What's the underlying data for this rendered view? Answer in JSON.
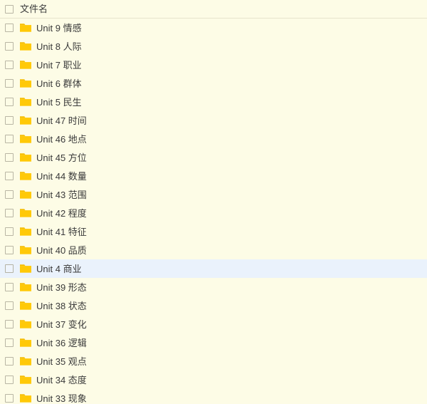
{
  "colors": {
    "background": "#fdfce6",
    "row_selected": "#eaf2fc",
    "folder_icon": "#ffc907",
    "folder_icon_tab": "#f5bd05",
    "text": "#3a3a3a",
    "checkbox_border": "#b9b6a4",
    "divider": "#e7e4cd"
  },
  "header": {
    "select_all_checkbox": "unchecked",
    "label": "文件名"
  },
  "files": [
    {
      "name": "Unit 9 情感",
      "icon": "folder-icon",
      "checked": false,
      "selected": false
    },
    {
      "name": "Unit 8 人际",
      "icon": "folder-icon",
      "checked": false,
      "selected": false
    },
    {
      "name": "Unit 7 职业",
      "icon": "folder-icon",
      "checked": false,
      "selected": false
    },
    {
      "name": "Unit 6 群体",
      "icon": "folder-icon",
      "checked": false,
      "selected": false
    },
    {
      "name": "Unit 5 民生",
      "icon": "folder-icon",
      "checked": false,
      "selected": false
    },
    {
      "name": "Unit 47 时间",
      "icon": "folder-icon",
      "checked": false,
      "selected": false
    },
    {
      "name": "Unit 46 地点",
      "icon": "folder-icon",
      "checked": false,
      "selected": false
    },
    {
      "name": "Unit 45 方位",
      "icon": "folder-icon",
      "checked": false,
      "selected": false
    },
    {
      "name": "Unit 44 数量",
      "icon": "folder-icon",
      "checked": false,
      "selected": false
    },
    {
      "name": "Unit 43 范围",
      "icon": "folder-icon",
      "checked": false,
      "selected": false
    },
    {
      "name": "Unit 42 程度",
      "icon": "folder-icon",
      "checked": false,
      "selected": false
    },
    {
      "name": "Unit 41 特征",
      "icon": "folder-icon",
      "checked": false,
      "selected": false
    },
    {
      "name": "Unit 40 品质",
      "icon": "folder-icon",
      "checked": false,
      "selected": false
    },
    {
      "name": "Unit 4 商业",
      "icon": "folder-icon",
      "checked": false,
      "selected": true
    },
    {
      "name": "Unit 39 形态",
      "icon": "folder-icon",
      "checked": false,
      "selected": false
    },
    {
      "name": "Unit 38 状态",
      "icon": "folder-icon",
      "checked": false,
      "selected": false
    },
    {
      "name": "Unit 37 变化",
      "icon": "folder-icon",
      "checked": false,
      "selected": false
    },
    {
      "name": "Unit 36 逻辑",
      "icon": "folder-icon",
      "checked": false,
      "selected": false
    },
    {
      "name": "Unit 35 观点",
      "icon": "folder-icon",
      "checked": false,
      "selected": false
    },
    {
      "name": "Unit 34 态度",
      "icon": "folder-icon",
      "checked": false,
      "selected": false
    },
    {
      "name": "Unit 33 现象",
      "icon": "folder-icon",
      "checked": false,
      "selected": false
    }
  ]
}
